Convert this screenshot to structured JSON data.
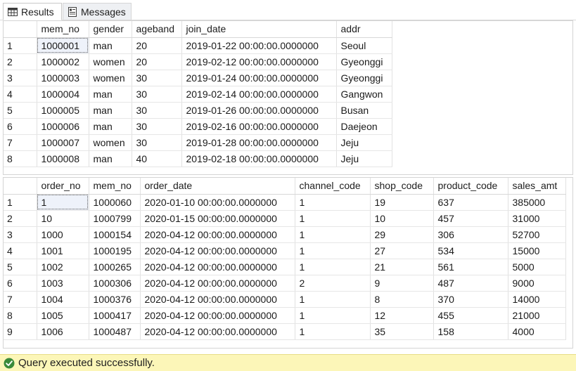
{
  "tabs": {
    "results_label": "Results",
    "messages_label": "Messages"
  },
  "grid1": {
    "columns": [
      "mem_no",
      "gender",
      "ageband",
      "join_date",
      "addr"
    ],
    "rows": [
      {
        "n": "1",
        "cells": [
          "1000001",
          "man",
          "20",
          "2019-01-22 00:00:00.0000000",
          "Seoul"
        ]
      },
      {
        "n": "2",
        "cells": [
          "1000002",
          "women",
          "20",
          "2019-02-12 00:00:00.0000000",
          "Gyeonggi"
        ]
      },
      {
        "n": "3",
        "cells": [
          "1000003",
          "women",
          "30",
          "2019-01-24 00:00:00.0000000",
          "Gyeonggi"
        ]
      },
      {
        "n": "4",
        "cells": [
          "1000004",
          "man",
          "30",
          "2019-02-14 00:00:00.0000000",
          "Gangwon"
        ]
      },
      {
        "n": "5",
        "cells": [
          "1000005",
          "man",
          "30",
          "2019-01-26 00:00:00.0000000",
          "Busan"
        ]
      },
      {
        "n": "6",
        "cells": [
          "1000006",
          "man",
          "30",
          "2019-02-16 00:00:00.0000000",
          "Daejeon"
        ]
      },
      {
        "n": "7",
        "cells": [
          "1000007",
          "women",
          "30",
          "2019-01-28 00:00:00.0000000",
          "Jeju"
        ]
      },
      {
        "n": "8",
        "cells": [
          "1000008",
          "man",
          "40",
          "2019-02-18 00:00:00.0000000",
          "Jeju"
        ]
      }
    ]
  },
  "grid2": {
    "columns": [
      "order_no",
      "mem_no",
      "order_date",
      "channel_code",
      "shop_code",
      "product_code",
      "sales_amt"
    ],
    "rows": [
      {
        "n": "1",
        "cells": [
          "1",
          "1000060",
          "2020-01-10 00:00:00.0000000",
          "1",
          "19",
          "637",
          "385000"
        ]
      },
      {
        "n": "2",
        "cells": [
          "10",
          "1000799",
          "2020-01-15 00:00:00.0000000",
          "1",
          "10",
          "457",
          "31000"
        ]
      },
      {
        "n": "3",
        "cells": [
          "1000",
          "1000154",
          "2020-04-12 00:00:00.0000000",
          "1",
          "29",
          "306",
          "52700"
        ]
      },
      {
        "n": "4",
        "cells": [
          "1001",
          "1000195",
          "2020-04-12 00:00:00.0000000",
          "1",
          "27",
          "534",
          "15000"
        ]
      },
      {
        "n": "5",
        "cells": [
          "1002",
          "1000265",
          "2020-04-12 00:00:00.0000000",
          "1",
          "21",
          "561",
          "5000"
        ]
      },
      {
        "n": "6",
        "cells": [
          "1003",
          "1000306",
          "2020-04-12 00:00:00.0000000",
          "2",
          "9",
          "487",
          "9000"
        ]
      },
      {
        "n": "7",
        "cells": [
          "1004",
          "1000376",
          "2020-04-12 00:00:00.0000000",
          "1",
          "8",
          "370",
          "14000"
        ]
      },
      {
        "n": "8",
        "cells": [
          "1005",
          "1000417",
          "2020-04-12 00:00:00.0000000",
          "1",
          "12",
          "455",
          "21000"
        ]
      },
      {
        "n": "9",
        "cells": [
          "1006",
          "1000487",
          "2020-04-12 00:00:00.0000000",
          "1",
          "35",
          "158",
          "4000"
        ]
      }
    ]
  },
  "status": {
    "message": "Query executed successfully.",
    "color": "#fcf6b8"
  },
  "icons": {
    "results": "grid-icon",
    "messages": "messages-icon",
    "status": "success-check-icon"
  }
}
